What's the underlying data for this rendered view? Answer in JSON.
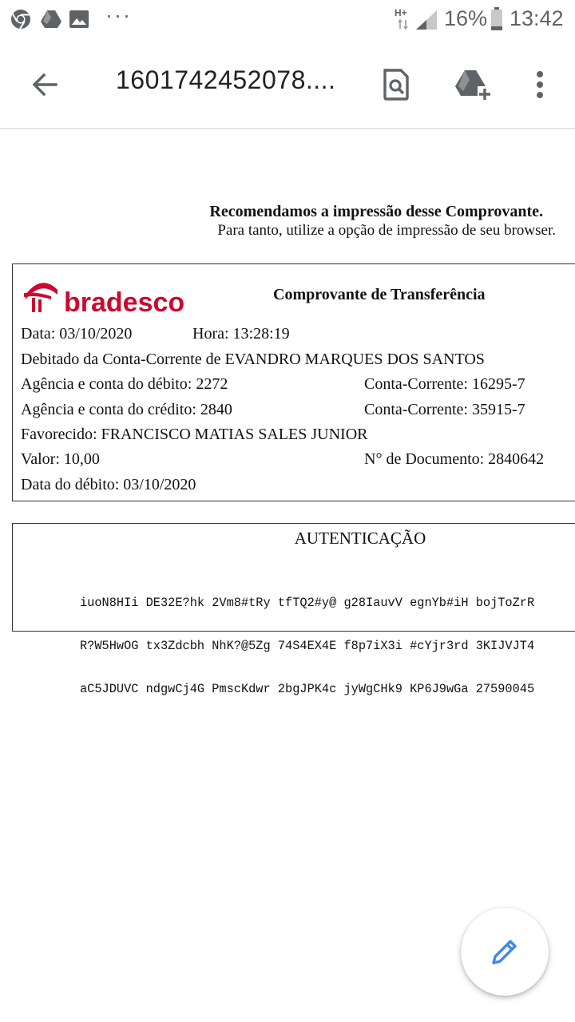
{
  "status_bar": {
    "network": "H+",
    "battery_percent": "16%",
    "time": "13:42",
    "more": "···",
    "icons": [
      "chrome-icon",
      "drive-icon",
      "image-icon",
      "signal-icon",
      "battery-icon"
    ]
  },
  "app_bar": {
    "title": "1601742452078....",
    "icons": [
      "back-arrow-icon",
      "find-in-page-icon",
      "add-to-drive-icon",
      "more-vert-icon"
    ]
  },
  "document": {
    "recommend_title": "Recomendamos a impressão desse Comprovante.",
    "recommend_sub": "Para tanto, utilize a opção de impressão de seu browser.",
    "logo_text": "bradesco",
    "receipt_title": "Comprovante de Transferência",
    "data_line": "Data: 03/10/2020",
    "hora_line": "Hora: 13:28:19",
    "debitado_line": "Debitado da Conta-Corrente de EVANDRO MARQUES DOS SANTOS",
    "agencia_debito": "Agência e conta do débito: 2272",
    "conta_debito": "Conta-Corrente: 16295-7",
    "agencia_credito": "Agência e conta do crédito: 2840",
    "conta_credito": "Conta-Corrente: 35915-7",
    "favorecido": "Favorecido:  FRANCISCO MATIAS SALES JUNIOR",
    "valor": "Valor: 10,00",
    "documento": "N° de Documento:  2840642",
    "data_debito": "Data do débito: 03/10/2020",
    "auth_title": "AUTENTICAÇÃO",
    "auth_lines": [
      "iuoN8HIi DE32E?hk 2Vm8#tRy tfTQ2#y@ g28IauvV egnYb#iH bojToZrR",
      "R?W5HwOG tx3Zdcbh NhK?@5Zg 74S4EX4E f8p7iX3i #cYjr3rd 3KIJVJT4",
      "aC5JDUVC ndgwCj4G PmscKdwr 2bgJPK4c jyWgCHk9 KP6J9wGa 27590045"
    ],
    "brand_color": "#cc092f"
  },
  "fab": {
    "icon": "edit-pencil-icon",
    "color": "#4285f4"
  }
}
